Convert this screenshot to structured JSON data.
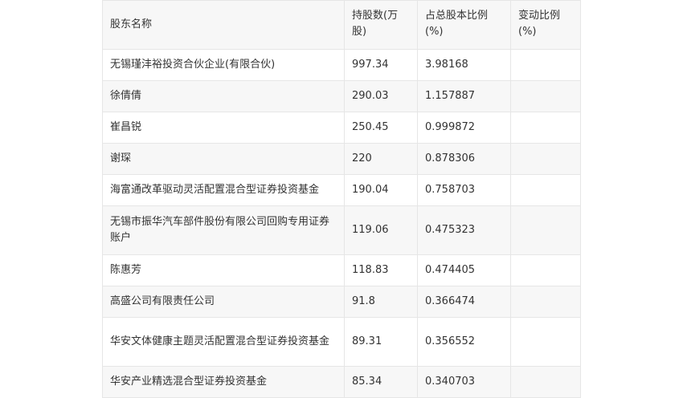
{
  "table": {
    "headers": [
      "股东名称",
      "持股数(万股)",
      "占总股本比例(%)",
      "变动比例(%)"
    ],
    "rows": [
      [
        "无锡瑾沣裕投资合伙企业(有限合伙)",
        "997.34",
        "3.98168",
        ""
      ],
      [
        "徐倩倩",
        "290.03",
        "1.157887",
        ""
      ],
      [
        "崔昌锐",
        "250.45",
        "0.999872",
        ""
      ],
      [
        "谢琛",
        "220",
        "0.878306",
        ""
      ],
      [
        "海富通改革驱动灵活配置混合型证券投资基金",
        "190.04",
        "0.758703",
        ""
      ],
      [
        "无锡市振华汽车部件股份有限公司回购专用证券账户",
        "119.06",
        "0.475323",
        ""
      ],
      [
        "陈惠芳",
        "118.83",
        "0.474405",
        ""
      ],
      [
        "高盛公司有限责任公司",
        "91.8",
        "0.366474",
        ""
      ],
      [
        "华安文体健康主题灵活配置混合型证券投资基金",
        "89.31",
        "0.356552",
        ""
      ],
      [
        "华安产业精选混合型证券投资基金",
        "85.34",
        "0.340703",
        ""
      ]
    ]
  }
}
